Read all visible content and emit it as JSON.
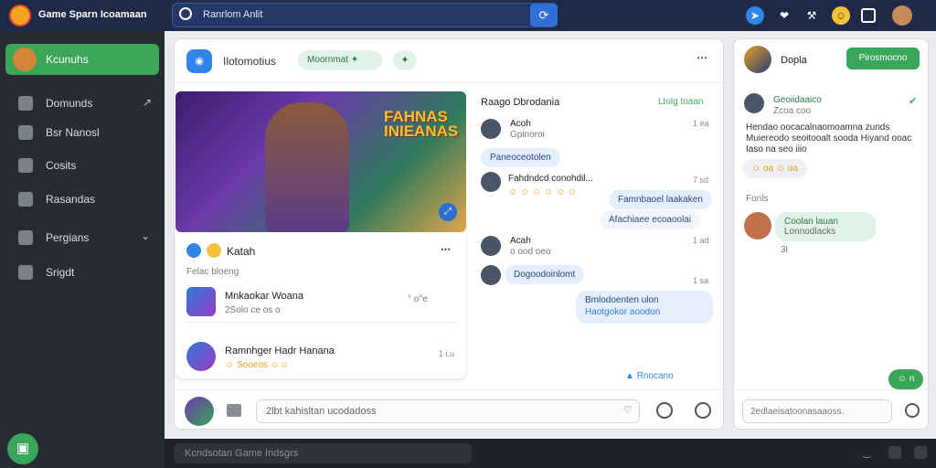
{
  "header": {
    "app_title": "Game Sparn Icoamaan",
    "search_text": "Ranrlom Anlit"
  },
  "sidebar": {
    "items": [
      {
        "label": "Kcunuhs"
      },
      {
        "label": "Domunds"
      },
      {
        "label": "Bsr Nanosl"
      },
      {
        "label": "Cosits"
      },
      {
        "label": "Rasandas"
      },
      {
        "label": "Pergians"
      },
      {
        "label": "Srigdt"
      }
    ]
  },
  "bottom_bar": {
    "input_text": "Kcndsotan Game Indsgrs"
  },
  "feed": {
    "title": "Ilotomotius",
    "tag": "Moornmat",
    "hero_title_line1": "FAHNAS",
    "hero_title_line2": "INIEANAS",
    "post_author": "Katah",
    "post_subtitle": "Felac bloeng",
    "items": [
      {
        "title": "Mnkaokar Woana",
        "sub": "2Solo ce os o",
        "count": "° o°e"
      },
      {
        "title": "Ramnhger Hadr Hanana",
        "sub": "☺ Sooeos ☺☺",
        "time": "1 i.u"
      }
    ]
  },
  "chat": {
    "header": "Raago Dbrodania",
    "header_action": "Ltolg toaan",
    "messages": [
      {
        "name": "Acoh",
        "sub": "Gpinoroi",
        "time": "1 ea"
      },
      {
        "bubble": "Paneoceotolen"
      },
      {
        "name": "Fahdndcd conohdil...",
        "emojis": "☺ ☺ ☺ ☺ ☺ ☺",
        "time": "7 sd"
      },
      {
        "bubble": "Famnbaoel laakaken"
      },
      {
        "bubble": "Afachiaee ecoaoolai"
      },
      {
        "name": "Acah",
        "sub": "o ood oeo",
        "time": "1 ad"
      },
      {
        "bubble": "Dogoodoinlomt",
        "time": "1 sa"
      },
      {
        "bubble": "Bmlodoenten ulon",
        "sub": "Haotgokor aoodon"
      },
      {
        "footer": "Rnocano"
      }
    ],
    "input_placeholder": "2lbt kahisltan ucodadoss"
  },
  "right_panel": {
    "title": "Dopla",
    "follow_button": "Pirosmocno",
    "post_name": "Geoiidaaico",
    "post_sub": "Zcoa coo",
    "post_body": "Hendao oocacalnaomoamna zunds Muiereodo seoitooalt sooda Hiyand ooac Iaso na seo iiio",
    "emoji_chip": "☺ oa ☺ oa",
    "section_label": "Fonls",
    "friend_name": "Coolan lauan",
    "friend_sub": "Lonnodlacks",
    "friend_count": "3l",
    "small_btn": "☺ n",
    "input_placeholder": "2edlaeisatoonasaaoss."
  },
  "colors": {
    "accent_green": "#3aa659",
    "accent_blue": "#2f86e8",
    "top_bar": "#1f2a48",
    "sidebar": "#272c33"
  }
}
